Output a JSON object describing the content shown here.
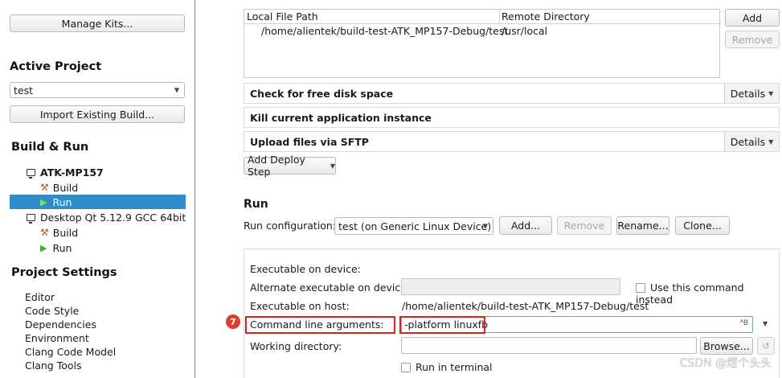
{
  "sidebar": {
    "manage_kits": "Manage Kits...",
    "active_project_heading": "Active Project",
    "project_combo": "test",
    "import_button": "Import Existing Build...",
    "build_run_heading": "Build & Run",
    "kits": [
      {
        "name": "ATK-MP157",
        "build": "Build",
        "run": "Run"
      },
      {
        "name": "Desktop Qt 5.12.9 GCC 64bit",
        "build": "Build",
        "run": "Run"
      }
    ],
    "project_settings_heading": "Project Settings",
    "settings_items": [
      "Editor",
      "Code Style",
      "Dependencies",
      "Environment",
      "Clang Code Model",
      "Clang Tools"
    ]
  },
  "deploy": {
    "table": {
      "headers": [
        "Local File Path",
        "Remote Directory"
      ],
      "rows": [
        [
          "/home/alientek/build-test-ATK_MP157-Debug/test",
          "/usr/local"
        ]
      ]
    },
    "add_button": "Add",
    "remove_button": "Remove",
    "steps": [
      {
        "label": "Check for free disk space",
        "details": "Details"
      },
      {
        "label": "Kill current application instance"
      },
      {
        "label": "Upload files via SFTP",
        "details": "Details"
      }
    ],
    "add_deploy_step": "Add Deploy Step"
  },
  "run": {
    "heading": "Run",
    "config_label": "Run configuration:",
    "config_value": "test (on Generic Linux Device)",
    "buttons": {
      "add": "Add...",
      "remove": "Remove",
      "rename": "Rename...",
      "clone": "Clone..."
    },
    "form": {
      "exec_on_device_label": "Executable on device:",
      "alt_exec_label": "Alternate executable on device:",
      "use_command_label": "Use this command instead",
      "exec_on_host_label": "Executable on host:",
      "exec_on_host_value": "/home/alientek/build-test-ATK_MP157-Debug/test",
      "cmd_args_label": "Command line arguments:",
      "cmd_args_value": "-platform linuxfb",
      "working_dir_label": "Working directory:",
      "browse_button": "Browse...",
      "run_in_terminal_label": "Run in terminal"
    }
  },
  "annotation": {
    "marker": "7"
  },
  "watermark": "CSDN @煜个头头",
  "colors": {
    "selection": "#308cc6",
    "highlight_box": "#e0201b",
    "marker": "#e03c2f"
  }
}
